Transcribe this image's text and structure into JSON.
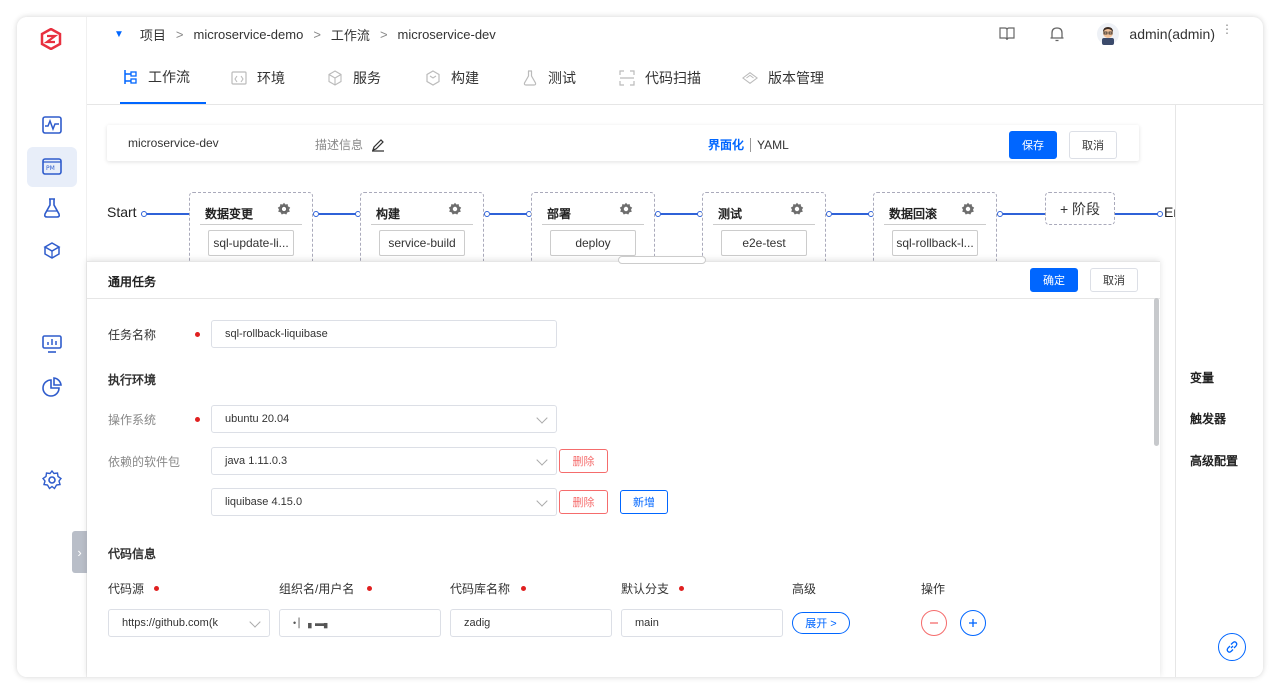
{
  "breadcrumb": {
    "items": [
      "项目",
      "microservice-demo",
      "工作流",
      "microservice-dev"
    ],
    "separator": ">"
  },
  "topbar": {
    "user": "admin(admin)"
  },
  "nav": {
    "tabs": [
      {
        "label": "工作流",
        "icon": "workflow-icon",
        "active": true
      },
      {
        "label": "环境",
        "icon": "code-window-icon"
      },
      {
        "label": "服务",
        "icon": "cube-icon"
      },
      {
        "label": "构建",
        "icon": "box-icon"
      },
      {
        "label": "测试",
        "icon": "flask-icon"
      },
      {
        "label": "代码扫描",
        "icon": "scan-icon"
      },
      {
        "label": "版本管理",
        "icon": "diamond-icon"
      }
    ]
  },
  "workflow": {
    "name": "microservice-dev",
    "desc_placeholder": "描述信息",
    "mode_ui": "界面化",
    "mode_yaml": "YAML",
    "save_label": "保存",
    "cancel_label": "取消"
  },
  "pipeline": {
    "start_label": "Start",
    "end_label": "End",
    "add_stage_label": "+ 阶段",
    "stages": [
      {
        "name": "数据变更",
        "job": "sql-update-li..."
      },
      {
        "name": "构建",
        "job": "service-build"
      },
      {
        "name": "部署",
        "job": "deploy"
      },
      {
        "name": "测试",
        "job": "e2e-test"
      },
      {
        "name": "数据回滚",
        "job": "sql-rollback-l..."
      }
    ]
  },
  "right_panel": {
    "items": [
      "变量",
      "触发器",
      "高级配置"
    ]
  },
  "drawer": {
    "title": "通用任务",
    "confirm_label": "确定",
    "cancel_label": "取消",
    "task_name_label": "任务名称",
    "task_name_value": "sql-rollback-liquibase",
    "exec_env_label": "执行环境",
    "os_label": "操作系统",
    "os_value": "ubuntu 20.04",
    "deps_label": "依赖的软件包",
    "deps": [
      {
        "value": "java 1.11.0.3",
        "delete_label": "删除"
      },
      {
        "value": "liquibase 4.15.0",
        "delete_label": "删除"
      }
    ],
    "add_label": "新增",
    "code_info_label": "代码信息",
    "repo_columns": [
      "代码源",
      "组织名/用户名",
      "代码库名称",
      "默认分支",
      "高级",
      "操作"
    ],
    "repo_row": {
      "source": "https://github.com(k",
      "org": "• ▏ ▖▬▖",
      "repo": "zadig",
      "branch": "main",
      "expand_label": "展开 >"
    }
  },
  "colors": {
    "accent": "#0066ff",
    "danger": "#f56c6c",
    "line": "#2f62d8"
  }
}
